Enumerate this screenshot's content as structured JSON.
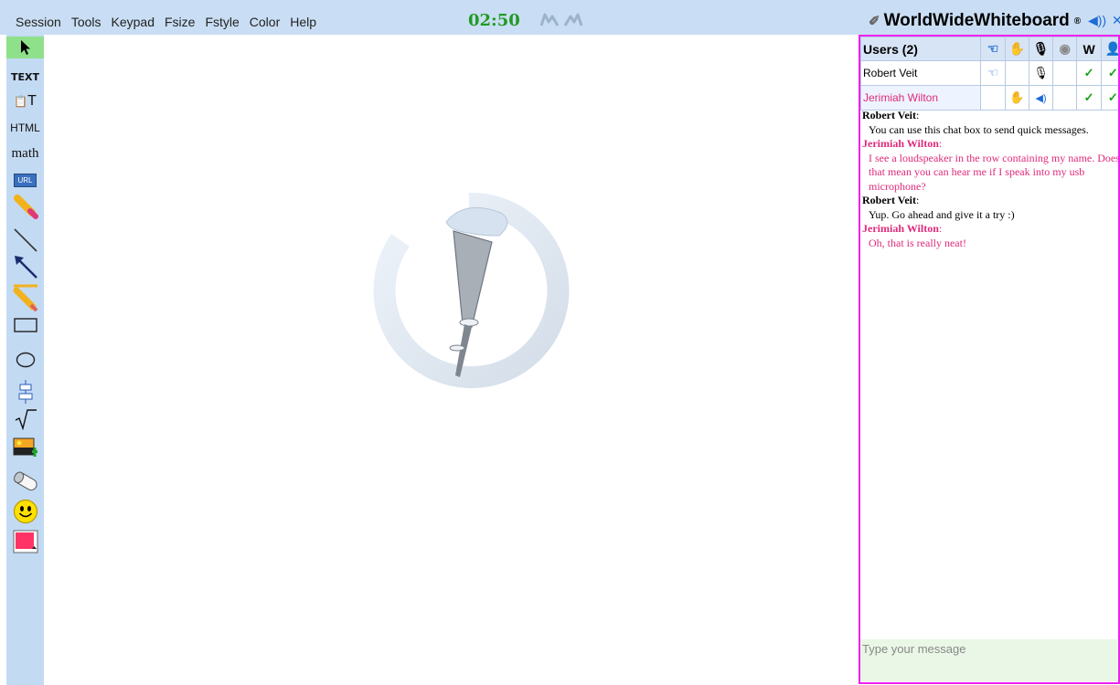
{
  "menu": [
    "Session",
    "Tools",
    "Keypad",
    "Fsize",
    "Fstyle",
    "Color",
    "Help"
  ],
  "timer": "02:50",
  "brand": {
    "name": "WorldWideWhiteboard",
    "mark": "®"
  },
  "toolbar": {
    "text_label": "TEXT",
    "html_label": "HTML",
    "math_label": "math",
    "textimport_label": "T",
    "url_label": "URL"
  },
  "users": {
    "header": "Users (2)",
    "rows": [
      {
        "name": "Robert Veit",
        "color": "#000000"
      },
      {
        "name": "Jerimiah Wilton",
        "color": "#e0297a"
      }
    ]
  },
  "chat": [
    {
      "sender": "Robert Veit",
      "sep": ":",
      "text": "You can use this chat box to send quick messages."
    },
    {
      "sender": "Jerimiah Wilton",
      "sep": ":",
      "text": "I see a loudspeaker in the row containing my name. Does that mean you can hear me if I speak into my usb microphone?"
    },
    {
      "sender": "Robert Veit",
      "sep": ":",
      "text": "Yup. Go ahead and give it a try :)"
    },
    {
      "sender": "Jerimiah Wilton",
      "sep": ":",
      "text": "Oh, that is really neat!"
    }
  ],
  "chat_input": {
    "placeholder": "Type your message"
  },
  "colors": {
    "accent": "#ee22ee",
    "menubar": "#c9def4",
    "timer": "#229922",
    "pen_color": "#ff3366",
    "jerimiah": "#e0297a"
  }
}
